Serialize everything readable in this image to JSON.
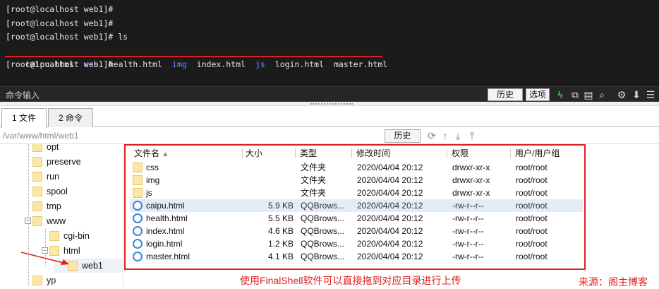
{
  "terminal": {
    "lines": [
      "[root@localhost web1]#",
      "[root@localhost web1]#",
      "[root@localhost web1]# ls"
    ],
    "ls_items": [
      {
        "name": "caipu.html",
        "type": "file"
      },
      {
        "name": "css",
        "type": "dir"
      },
      {
        "name": "health.html",
        "type": "file"
      },
      {
        "name": "img",
        "type": "dir"
      },
      {
        "name": "index.html",
        "type": "file"
      },
      {
        "name": "js",
        "type": "dir"
      },
      {
        "name": "login.html",
        "type": "file"
      },
      {
        "name": "master.html",
        "type": "file"
      }
    ],
    "last_line": "[root@localhost web1]#",
    "dir_color": "#5a8cff",
    "underline_color": "#e02020"
  },
  "cmdbar": {
    "label": "命令输入",
    "history_btn": "历史",
    "options_btn": "选项",
    "icons": [
      "bolt-icon",
      "copy-icon",
      "paste-icon",
      "search-icon",
      "gear-icon",
      "download-icon",
      "menu-icon"
    ]
  },
  "tabs": [
    {
      "label": "1 文件",
      "active": true
    },
    {
      "label": "2 命令",
      "active": false
    }
  ],
  "pathbar": {
    "path": "/var/www/html/web1",
    "history_btn": "历史",
    "icons": [
      "refresh-icon",
      "up-arrow-icon",
      "download-icon",
      "upload-icon"
    ]
  },
  "tree": {
    "items": [
      {
        "label": "opt"
      },
      {
        "label": "preserve"
      },
      {
        "label": "run"
      },
      {
        "label": "spool"
      },
      {
        "label": "tmp"
      },
      {
        "label": "www"
      },
      {
        "label": "cgi-bin"
      },
      {
        "label": "html"
      },
      {
        "label": "web1",
        "selected": true
      },
      {
        "label": "yp"
      }
    ]
  },
  "filelist": {
    "columns": [
      "文件名",
      "大小",
      "类型",
      "修改时间",
      "权限",
      "用户/用户组"
    ],
    "sort_indicator": "▲",
    "rows": [
      {
        "name": "css",
        "size": "",
        "type": "文件夹",
        "mtime": "2020/04/04 20:12",
        "perm": "drwxr-xr-x",
        "owner": "root/root",
        "kind": "folder"
      },
      {
        "name": "img",
        "size": "",
        "type": "文件夹",
        "mtime": "2020/04/04 20:12",
        "perm": "drwxr-xr-x",
        "owner": "root/root",
        "kind": "folder"
      },
      {
        "name": "js",
        "size": "",
        "type": "文件夹",
        "mtime": "2020/04/04 20:12",
        "perm": "drwxr-xr-x",
        "owner": "root/root",
        "kind": "folder"
      },
      {
        "name": "caipu.html",
        "size": "5.9 KB",
        "type": "QQBrows...",
        "mtime": "2020/04/04 20:12",
        "perm": "-rw-r--r--",
        "owner": "root/root",
        "kind": "file",
        "highlighted": true
      },
      {
        "name": "health.html",
        "size": "5.5 KB",
        "type": "QQBrows...",
        "mtime": "2020/04/04 20:12",
        "perm": "-rw-r--r--",
        "owner": "root/root",
        "kind": "file"
      },
      {
        "name": "index.html",
        "size": "4.6 KB",
        "type": "QQBrows...",
        "mtime": "2020/04/04 20:12",
        "perm": "-rw-r--r--",
        "owner": "root/root",
        "kind": "file"
      },
      {
        "name": "login.html",
        "size": "1.2 KB",
        "type": "QQBrows...",
        "mtime": "2020/04/04 20:12",
        "perm": "-rw-r--r--",
        "owner": "root/root",
        "kind": "file"
      },
      {
        "name": "master.html",
        "size": "4.1 KB",
        "type": "QQBrows...",
        "mtime": "2020/04/04 20:12",
        "perm": "-rw-r--r--",
        "owner": "root/root",
        "kind": "file"
      }
    ]
  },
  "annotation": {
    "caption": "使用FinalShell软件可以直接拖到对应目录进行上传",
    "source": "来源：阁主博客",
    "color": "#e02020"
  }
}
